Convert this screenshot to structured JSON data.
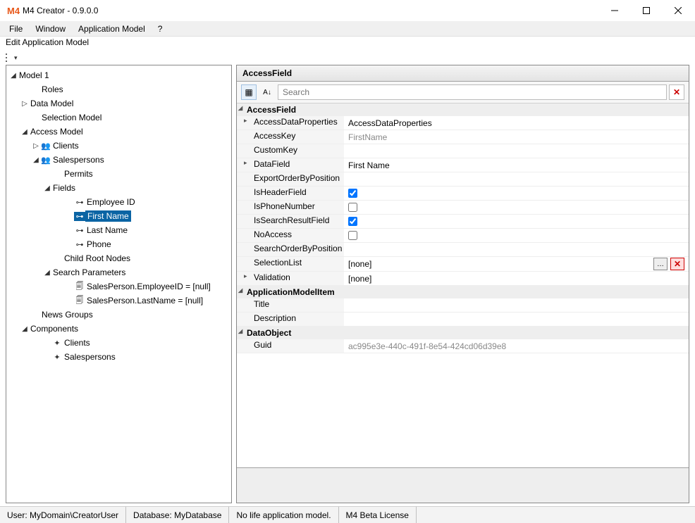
{
  "window": {
    "title": "M4 Creator - 0.9.0.0",
    "logo": "M4"
  },
  "menu": {
    "file": "File",
    "window": "Window",
    "appmodel": "Application Model",
    "help": "?"
  },
  "subheader": "Edit Application Model",
  "tree": {
    "model1": "Model 1",
    "roles": "Roles",
    "datamodel": "Data Model",
    "selectionmodel": "Selection Model",
    "accessmodel": "Access Model",
    "clients": "Clients",
    "salespersons": "Salespersons",
    "permits": "Permits",
    "fields": "Fields",
    "employeeid": "Employee ID",
    "firstname": "First Name",
    "lastname": "Last Name",
    "phone": "Phone",
    "childroot": "Child Root Nodes",
    "searchparams": "Search Parameters",
    "sp_emp": "SalesPerson.EmployeeID = [null]",
    "sp_last": "SalesPerson.LastName = [null]",
    "newsgroups": "News Groups",
    "components": "Components",
    "comp_clients": "Clients",
    "comp_sales": "Salespersons"
  },
  "prop": {
    "header": "AccessField",
    "search_placeholder": "Search",
    "cat_accessfield": "AccessField",
    "cat_appmodelitem": "ApplicationModelItem",
    "cat_dataobject": "DataObject",
    "rows": {
      "accessdataprops": {
        "label": "AccessDataProperties",
        "value": "AccessDataProperties"
      },
      "accesskey": {
        "label": "AccessKey",
        "value": "FirstName"
      },
      "customkey": {
        "label": "CustomKey",
        "value": ""
      },
      "datafield": {
        "label": "DataField",
        "value": "First Name"
      },
      "exportorder": {
        "label": "ExportOrderByPosition",
        "value": ""
      },
      "isheader": {
        "label": "IsHeaderField",
        "checked": true
      },
      "isphone": {
        "label": "IsPhoneNumber",
        "checked": false
      },
      "issearch": {
        "label": "IsSearchResultField",
        "checked": true
      },
      "noaccess": {
        "label": "NoAccess",
        "checked": false
      },
      "searchorder": {
        "label": "SearchOrderByPosition",
        "value": ""
      },
      "selectionlist": {
        "label": "SelectionList",
        "value": "[none]"
      },
      "validation": {
        "label": "Validation",
        "value": "[none]"
      },
      "title": {
        "label": "Title",
        "value": ""
      },
      "description": {
        "label": "Description",
        "value": ""
      },
      "guid": {
        "label": "Guid",
        "value": "ac995e3e-440c-491f-8e54-424cd06d39e8"
      }
    }
  },
  "status": {
    "user": "User: MyDomain\\CreatorUser",
    "db": "Database: MyDatabase",
    "life": "No life application model.",
    "license": "M4 Beta License"
  }
}
